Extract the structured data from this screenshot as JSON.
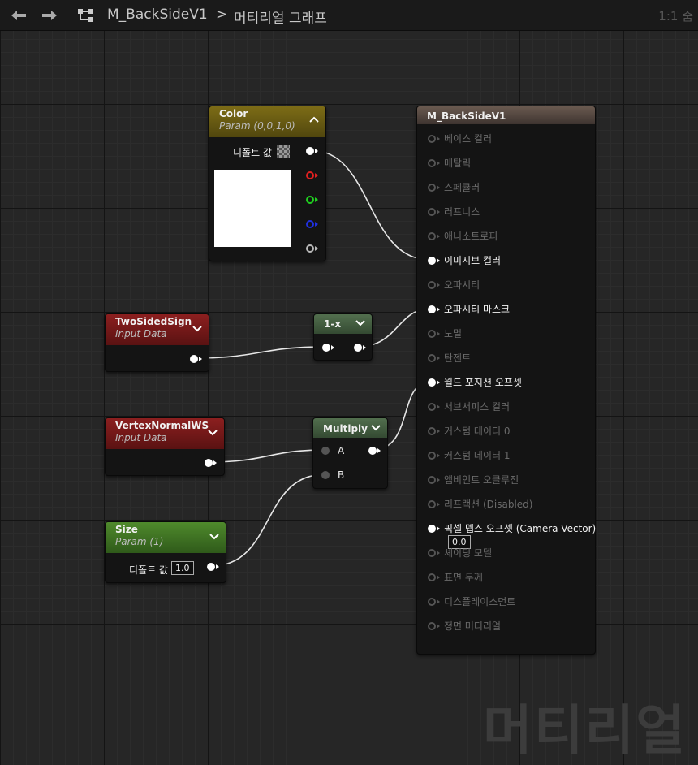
{
  "toolbar": {
    "asset_name": "M_BackSideV1",
    "separator": ">",
    "graph_name": "머티리얼 그래프",
    "zoom": "1:1 줌"
  },
  "nodes": {
    "color": {
      "title": "Color",
      "subtitle": "Param (0,0,1,0)",
      "default_label": "디폴트 값",
      "swatch_color": "#ffffff"
    },
    "two_sided": {
      "title": "TwoSidedSign",
      "subtitle": "Input Data"
    },
    "one_minus": {
      "title": "1-x"
    },
    "vertex_normal": {
      "title": "VertexNormalWS",
      "subtitle": "Input Data"
    },
    "multiply": {
      "title": "Multiply",
      "pin_a": "A",
      "pin_b": "B"
    },
    "size": {
      "title": "Size",
      "subtitle": "Param (1)",
      "default_label": "디폴트 값",
      "default_value": "1.0"
    }
  },
  "material": {
    "title": "M_BackSideV1",
    "pixel_depth_value": "0.0",
    "outputs": [
      {
        "label": "베이스 컬러",
        "connected": false
      },
      {
        "label": "메탈릭",
        "connected": false
      },
      {
        "label": "스페큘러",
        "connected": false
      },
      {
        "label": "러프니스",
        "connected": false
      },
      {
        "label": "애니소트로피",
        "connected": false
      },
      {
        "label": "이미시브 컬러",
        "connected": true
      },
      {
        "label": "오파시티",
        "connected": false
      },
      {
        "label": "오파시티 마스크",
        "connected": true
      },
      {
        "label": "노멀",
        "connected": false
      },
      {
        "label": "탄젠트",
        "connected": false
      },
      {
        "label": "월드 포지션 오프셋",
        "connected": true
      },
      {
        "label": "서브서피스 컬러",
        "connected": false
      },
      {
        "label": "커스텀 데이터 0",
        "connected": false
      },
      {
        "label": "커스텀 데이터 1",
        "connected": false
      },
      {
        "label": "앰비언트 오클루전",
        "connected": false
      },
      {
        "label": "리프랙션 (Disabled)",
        "connected": false
      },
      {
        "label": "픽셀 뎁스 오프셋 (Camera Vector)",
        "connected": true
      },
      {
        "label": "셰이딩 모델",
        "connected": false
      },
      {
        "label": "표면 두께",
        "connected": false
      },
      {
        "label": "디스플레이스먼트",
        "connected": false
      },
      {
        "label": "정면 머티리얼",
        "connected": false
      }
    ]
  },
  "colors": {
    "param_header": "#7a6a14",
    "input_header": "#8a1c1c",
    "math_header": "#4a6a48",
    "size_header": "#4a7a2a",
    "material_header": "#5a4a42",
    "wire": "#e6e6e6"
  },
  "watermark": "머티리얼"
}
